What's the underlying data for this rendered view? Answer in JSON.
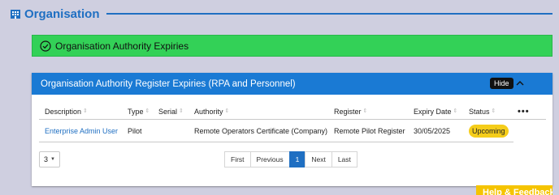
{
  "header": {
    "title": "Organisation"
  },
  "banner": {
    "text": "Organisation Authority Expiries"
  },
  "card": {
    "title": "Organisation Authority Register Expiries (RPA and Personnel)",
    "hide_tooltip": "Hide"
  },
  "table": {
    "columns": [
      "Description",
      "Type",
      "Serial",
      "Authority",
      "Register",
      "Expiry Date",
      "Status"
    ],
    "more_label": "•••",
    "rows": [
      {
        "description": "Enterprise Admin User",
        "type": "Pilot",
        "serial": "",
        "authority": "Remote Operators Certificate (Company)",
        "register": "Remote Pilot Register",
        "expiry_date": "30/05/2025",
        "status": "Upcoming"
      }
    ]
  },
  "pagination": {
    "page_size": "3",
    "first": "First",
    "previous": "Previous",
    "current": "1",
    "next": "Next",
    "last": "Last"
  },
  "help": {
    "label": "Help & Feedback"
  },
  "colors": {
    "accent": "#1f6fc2",
    "header_bar": "#1a7ad4",
    "banner_green": "#33d157",
    "status_upcoming": "#f5cd1a",
    "help_yellow": "#f5c400"
  }
}
